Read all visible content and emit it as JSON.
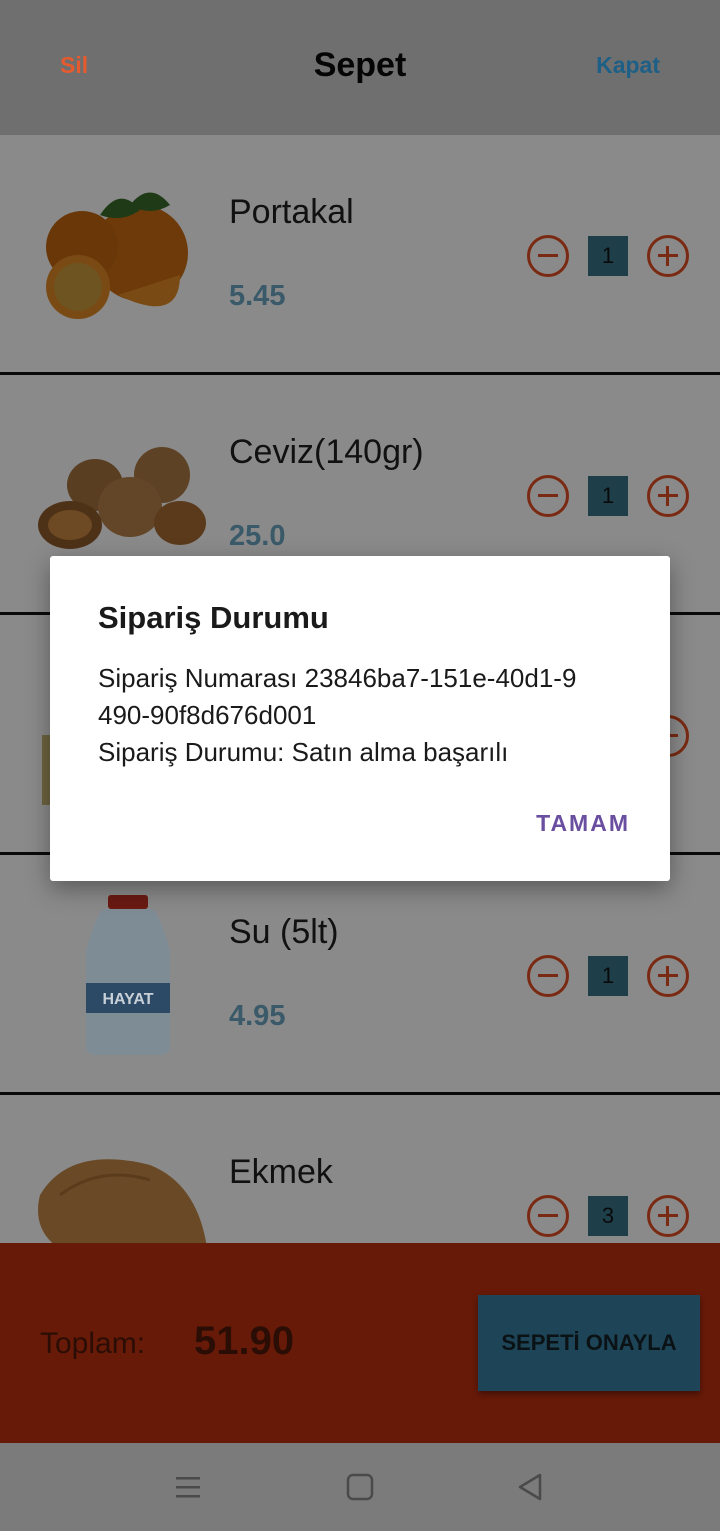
{
  "header": {
    "left_action": "Sil",
    "title": "Sepet",
    "right_action": "Kapat"
  },
  "items": [
    {
      "name": "Portakal",
      "price": "5.45",
      "qty": "1",
      "image": "orange"
    },
    {
      "name": "Ceviz(140gr)",
      "price": "25.0",
      "qty": "1",
      "image": "walnut"
    },
    {
      "name": "",
      "price": "",
      "qty": "",
      "image": "package"
    },
    {
      "name": "Su (5lt)",
      "price": "4.95",
      "qty": "1",
      "image": "water-bottle",
      "brand": "HAYAT"
    },
    {
      "name": "Ekmek",
      "price": "",
      "qty": "3",
      "image": "bread"
    }
  ],
  "footer": {
    "total_label": "Toplam:",
    "total_value": "51.90",
    "confirm_label": "SEPETİ ONAYLA"
  },
  "dialog": {
    "title": "Sipariş Durumu",
    "line1": "Sipariş Numarası 23846ba7-151e-40d1-9",
    "line2": "490-90f8d676d001",
    "line3": "Sipariş Durumu: Satın alma başarılı",
    "ok_label": "TAMAM"
  },
  "colors": {
    "delete": "#e55a2e",
    "close": "#1d5f86",
    "footer": "#681a08",
    "dialog_button": "#6a4fa0"
  },
  "sysnav": {
    "icons": [
      "menu-icon",
      "home-square-icon",
      "back-triangle-icon"
    ]
  }
}
